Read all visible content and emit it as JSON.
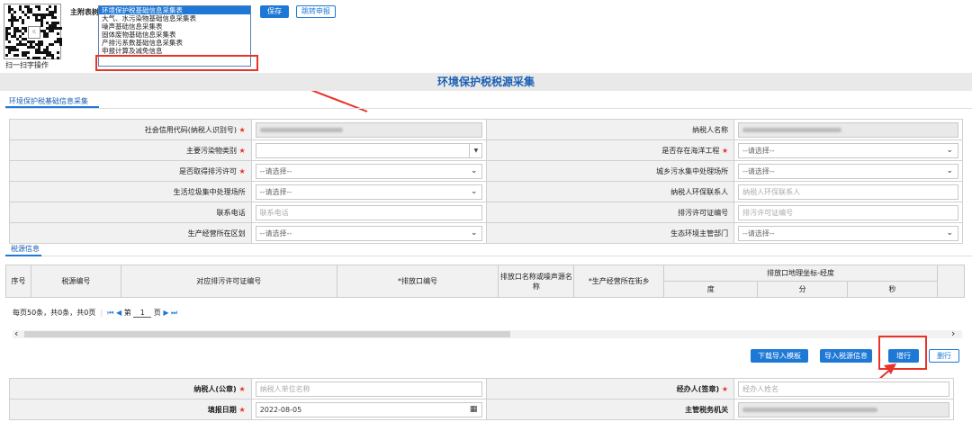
{
  "qr": {
    "scan_text": "扫一扫字操作"
  },
  "form_bar": {
    "label": "主附表树:",
    "options": [
      "环境保护税基础信息采集表",
      "大气、水污染物基础信息采集表",
      "噪声基础信息采集表",
      "固体废物基础信息采集表",
      "产排污系数基础信息采集表",
      "申报计算及减免信息"
    ],
    "selected_index": 0,
    "highlighted_index": 5,
    "save": "保存",
    "jump": "跳转申报"
  },
  "title": "环境保护税税源采集",
  "tab": "环境保护税基础信息采集",
  "fields": {
    "credit_code": {
      "label": "社会信用代码(纳税人识别号)",
      "required": true
    },
    "taxpayer_name": {
      "label": "纳税人名称",
      "required": false
    },
    "pollutant": {
      "label": "主要污染物类别",
      "required": true
    },
    "ocean": {
      "label": "是否存在海洋工程",
      "required": true,
      "value": "--请选择--"
    },
    "permit": {
      "label": "是否取得排污许可",
      "required": true,
      "value": "--请选择--"
    },
    "sewage": {
      "label": "城乡污水集中处理场所",
      "required": false,
      "value": "--请选择--"
    },
    "garbage": {
      "label": "生活垃圾集中处理场所",
      "required": false,
      "value": "--请选择--"
    },
    "contact": {
      "label": "纳税人环保联系人",
      "required": false,
      "placeholder": "纳税人环保联系人"
    },
    "phone": {
      "label": "联系电话",
      "required": false,
      "placeholder": "联系电话"
    },
    "permit_no": {
      "label": "排污许可证编号",
      "required": false,
      "placeholder": "排污许可证编号"
    },
    "district": {
      "label": "生产经营所在区划",
      "required": false,
      "value": "--请选择--"
    },
    "eco_dept": {
      "label": "生态环境主管部门",
      "required": false,
      "value": "--请选择--"
    }
  },
  "tax_source": {
    "tab": "税源信息",
    "columns": {
      "seq": "序号",
      "code": "税源编号",
      "permit": "对应排污许可证编号",
      "outlet": "*排放口编号",
      "outlet_name": "排放口名称或噪声源名称",
      "street": "*生产经营所在街乡",
      "geo": "排放口地理坐标-经度",
      "deg": "度",
      "min": "分",
      "sec": "秒"
    },
    "pager": {
      "summary": "每页50条，共0条，共0页",
      "page_label": "第",
      "page": "1",
      "page_unit": "页"
    }
  },
  "actions": {
    "download": "下载导入模板",
    "import": "导入税源信息",
    "add": "增行",
    "delete": "删行"
  },
  "footer": {
    "taxpayer": {
      "label": "纳税人(公章)",
      "placeholder": "纳税人单位名称"
    },
    "agent": {
      "label": "经办人(签章)",
      "placeholder": "经办人姓名"
    },
    "date": {
      "label": "填报日期",
      "value": "2022-08-05"
    },
    "authority": {
      "label": "主管税务机关"
    }
  },
  "colors": {
    "accent": "#1e78d6",
    "alert": "#e8332b"
  }
}
